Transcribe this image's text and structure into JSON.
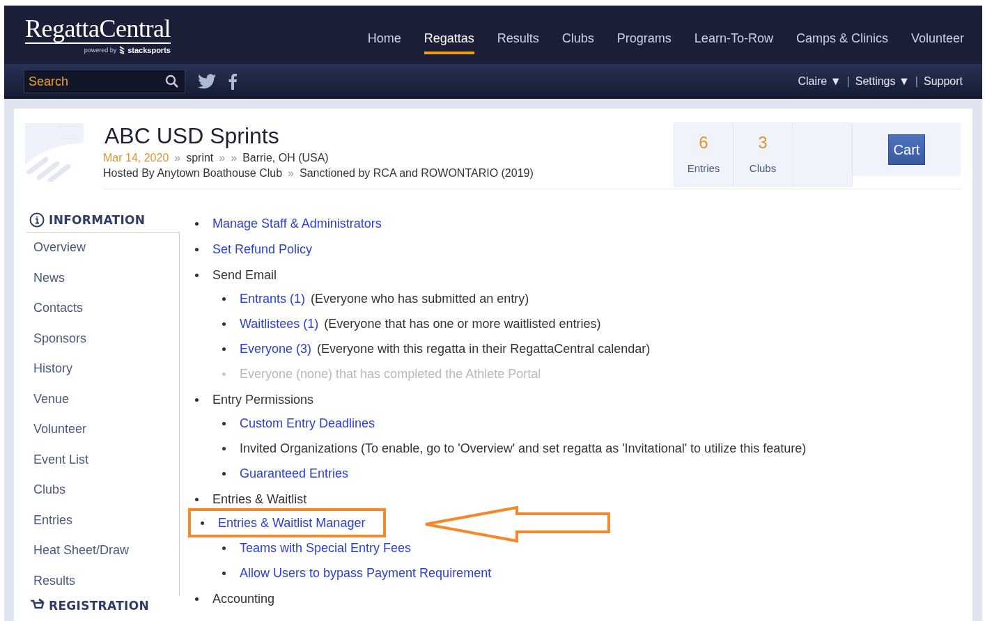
{
  "header": {
    "logo": "RegattaCentral",
    "powered_by": "powered by",
    "partner": "stacksports",
    "nav": [
      {
        "label": "Home",
        "selected": false
      },
      {
        "label": "Regattas",
        "selected": true
      },
      {
        "label": "Results",
        "selected": false
      },
      {
        "label": "Clubs",
        "selected": false
      },
      {
        "label": "Programs",
        "selected": false
      },
      {
        "label": "Learn-To-Row",
        "selected": false
      },
      {
        "label": "Camps & Clinics",
        "selected": false
      },
      {
        "label": "Volunteer",
        "selected": false
      }
    ],
    "search": {
      "placeholder": "Search"
    },
    "user_links": [
      {
        "kind": "link",
        "text": "Claire ▼"
      },
      {
        "kind": "sep",
        "text": "|"
      },
      {
        "kind": "link",
        "text": "Settings ▼"
      },
      {
        "kind": "sep",
        "text": "|"
      },
      {
        "kind": "link",
        "text": "Support"
      }
    ]
  },
  "event": {
    "title": "ABC USD Sprints",
    "meta": [
      {
        "kind": "date",
        "text": "Mar 14, 2020"
      },
      {
        "kind": "sep",
        "text": "»"
      },
      {
        "kind": "text",
        "text": "sprint"
      },
      {
        "kind": "sep",
        "text": "»"
      },
      {
        "kind": "sep",
        "text": "»"
      },
      {
        "kind": "text",
        "text": "Barrie, OH (USA)"
      }
    ],
    "host": [
      {
        "kind": "text",
        "text": "Hosted By Anytown Boathouse Club"
      },
      {
        "kind": "sep",
        "text": "»"
      },
      {
        "kind": "text",
        "text": "Sanctioned by RCA and ROWONTARIO (2019)"
      }
    ],
    "stats": [
      {
        "value": "6",
        "label": "Entries"
      },
      {
        "value": "3",
        "label": "Clubs"
      }
    ],
    "cart": "Cart"
  },
  "sidebar": [
    {
      "title": "INFORMATION",
      "items": [
        "Overview",
        "News",
        "Contacts",
        "Sponsors",
        "History",
        "Venue",
        "Volunteer",
        "Event List",
        "Clubs",
        "Entries",
        "Heat Sheet/Draw",
        "Results"
      ]
    },
    {
      "title": "REGISTRATION"
    }
  ],
  "content": [
    {
      "kind": "link",
      "text": "Manage Staff & Administrators",
      "disabled": false,
      "highlighted": false
    },
    {
      "kind": "link",
      "text": "Set Refund Policy",
      "disabled": false,
      "highlighted": false
    },
    {
      "kind": "text",
      "text": "Send Email",
      "disabled": false,
      "highlighted": false,
      "children": [
        {
          "kind": "link",
          "text": "Entrants (1)",
          "note": "(Everyone who has submitted an entry)",
          "disabled": false,
          "highlighted": false
        },
        {
          "kind": "link",
          "text": "Waitlistees (1)",
          "note": "(Everyone that has one or more waitlisted entries)",
          "disabled": false,
          "highlighted": false
        },
        {
          "kind": "link",
          "text": "Everyone (3)",
          "note": "(Everyone with this regatta in their RegattaCentral calendar)",
          "disabled": false,
          "highlighted": false
        },
        {
          "kind": "text",
          "text": "Everyone (none) that has completed the Athlete Portal",
          "disabled": true,
          "highlighted": false
        }
      ]
    },
    {
      "kind": "text",
      "text": "Entry Permissions",
      "disabled": false,
      "highlighted": false,
      "children": [
        {
          "kind": "link",
          "text": "Custom Entry Deadlines",
          "disabled": false,
          "highlighted": false
        },
        {
          "kind": "text",
          "text": "Invited Organizations (To enable, go to 'Overview' and set regatta as 'Invitational' to utilize this feature)",
          "disabled": false,
          "highlighted": false
        },
        {
          "kind": "link",
          "text": "Guaranteed Entries",
          "disabled": false,
          "highlighted": false
        }
      ]
    },
    {
      "kind": "text",
      "text": "Entries & Waitlist",
      "disabled": false,
      "highlighted": false,
      "children": [
        {
          "kind": "link",
          "text": "Entries & Waitlist Manager",
          "disabled": false,
          "highlighted": true
        },
        {
          "kind": "link",
          "text": "Teams with Special Entry Fees",
          "disabled": false,
          "highlighted": false
        },
        {
          "kind": "link",
          "text": "Allow Users to bypass Payment Requirement",
          "disabled": false,
          "highlighted": false
        }
      ]
    },
    {
      "kind": "text",
      "text": "Accounting",
      "disabled": false,
      "highlighted": false
    }
  ]
}
